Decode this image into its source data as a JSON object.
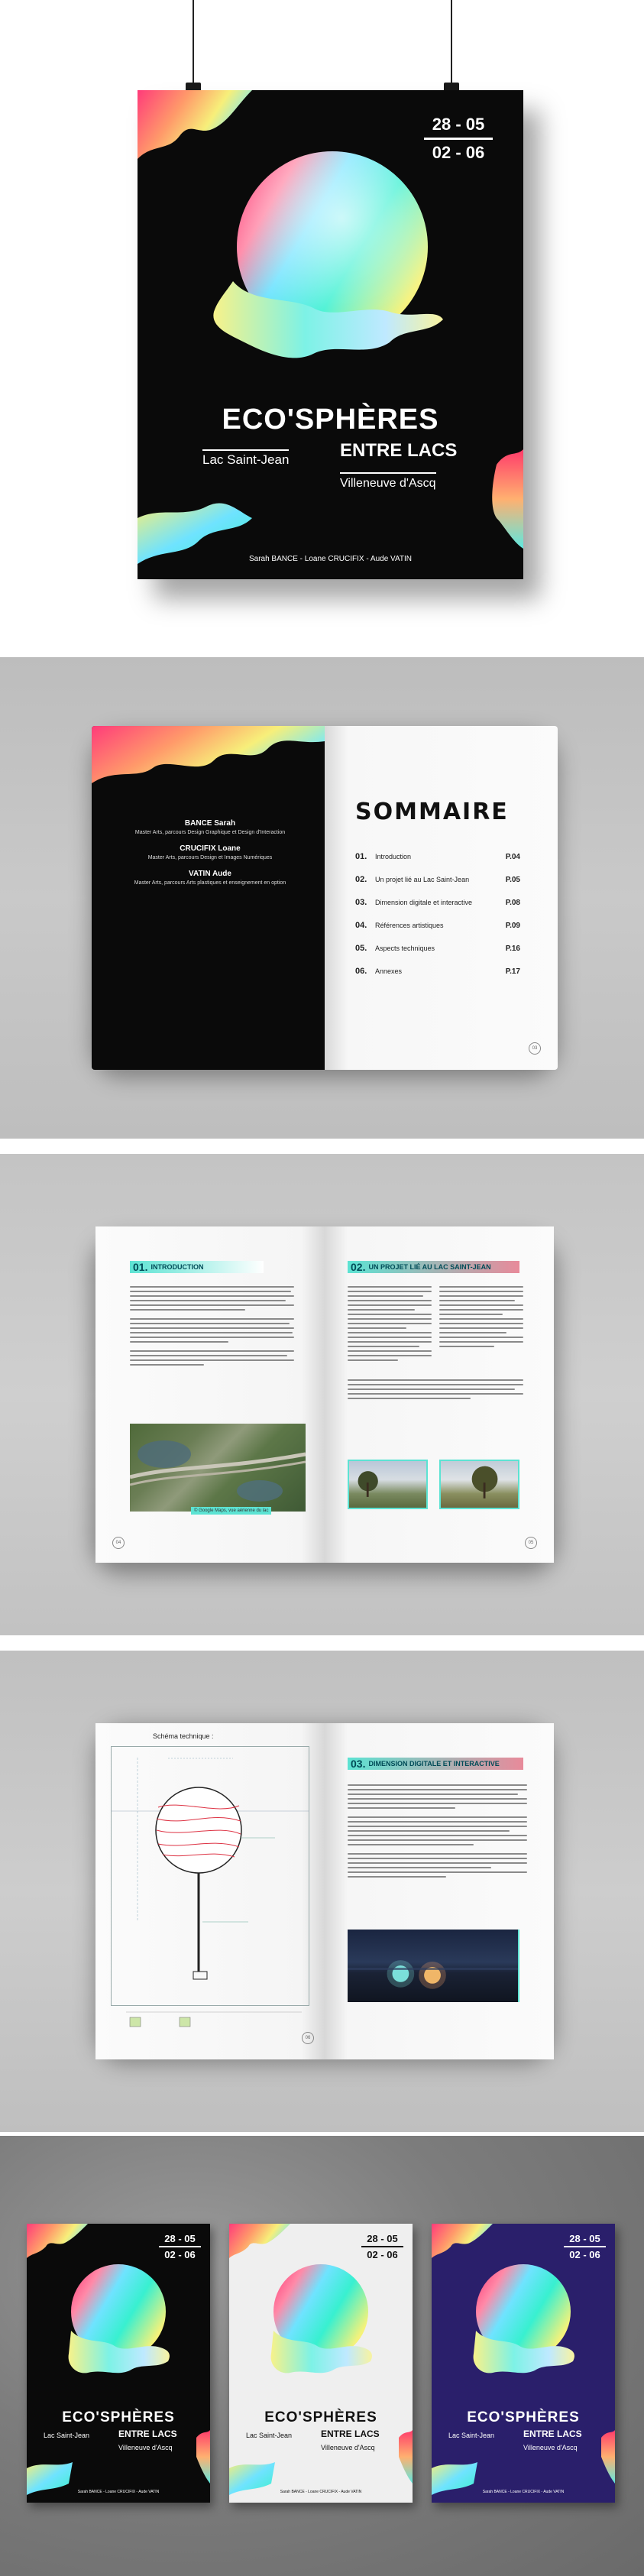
{
  "poster": {
    "date_start": "28 - 05",
    "date_end": "02 - 06",
    "title": "ECO'SPHÈRES",
    "location_left": "Lac Saint-Jean",
    "location_right": "ENTRE LACS",
    "city": "Villeneuve d'Ascq",
    "authors": "Sarah BANCE  -  Loane CRUCIFIX  -  Aude VATIN"
  },
  "summary_spread": {
    "members": [
      {
        "name": "BANCE Sarah",
        "role": "Master Arts, parcours Design Graphique et Design d'Interaction"
      },
      {
        "name": "CRUCIFIX Loane",
        "role": "Master Arts, parcours Design et Images Numériques"
      },
      {
        "name": "VATIN Aude",
        "role": "Master Arts, parcours Arts plastiques et enseignement en option"
      }
    ],
    "toc_title": "SOMMAIRE",
    "toc": [
      {
        "num": "01.",
        "label": "Introduction",
        "page": "P.04"
      },
      {
        "num": "02.",
        "label": "Un projet lié au Lac Saint-Jean",
        "page": "P.05"
      },
      {
        "num": "03.",
        "label": "Dimension digitale et interactive",
        "page": "P.08"
      },
      {
        "num": "04.",
        "label": "Références artistiques",
        "page": "P.09"
      },
      {
        "num": "05.",
        "label": "Aspects techniques",
        "page": "P.16"
      },
      {
        "num": "06.",
        "label": "Annexes",
        "page": "P.17"
      }
    ],
    "page_number": "03"
  },
  "intro_spread": {
    "left_heading_num": "01.",
    "left_heading": "INTRODUCTION",
    "right_heading_num": "02.",
    "right_heading": "UN PROJET LIÉ AU LAC SAINT-JEAN",
    "caption": "© Google Maps, vue aérienne du lac",
    "left_page_number": "04",
    "right_page_number": "05"
  },
  "tech_spread": {
    "schema_title": "Schéma technique :",
    "right_heading_num": "03.",
    "right_heading": "DIMENSION DIGITALE ET INTERACTIVE",
    "left_page_number": "06"
  },
  "posters_row": {
    "variants": [
      "black",
      "white",
      "purple"
    ]
  },
  "colors": {
    "accent_teal": "#5ce3d3",
    "accent_pink": "#e88a9a",
    "poster_black": "#0a0a0a",
    "poster_white": "#efefef",
    "poster_purple": "#2a1f6b"
  }
}
